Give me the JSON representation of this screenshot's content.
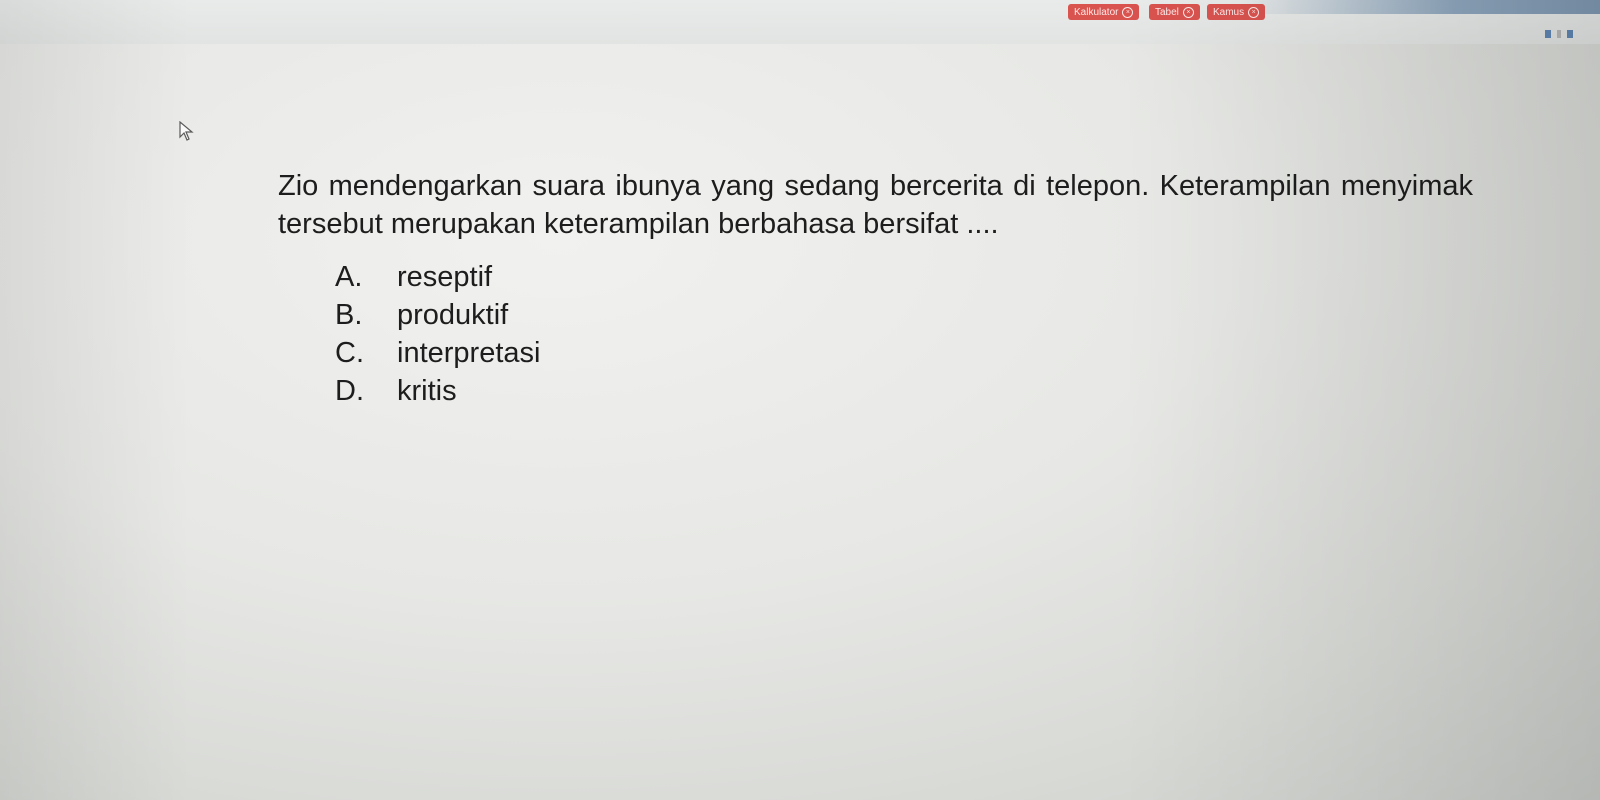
{
  "toolbar": {
    "kalkulator": "Kalkulator",
    "tabel": "Tabel",
    "kamus": "Kamus",
    "close_glyph": "×",
    "button_color": "#d9534f"
  },
  "question": {
    "text": "Zio mendengarkan suara ibunya yang sedang bercerita di telepon. Keterampilan menyimak tersebut merupakan keterampilan berbahasa bersifat ...."
  },
  "options": [
    {
      "letter": "A.",
      "text": "reseptif"
    },
    {
      "letter": "B.",
      "text": "produktif"
    },
    {
      "letter": "C.",
      "text": "interpretasi"
    },
    {
      "letter": "D.",
      "text": "kritis"
    }
  ],
  "icons": {
    "cursor": "mouse-pointer-icon"
  }
}
